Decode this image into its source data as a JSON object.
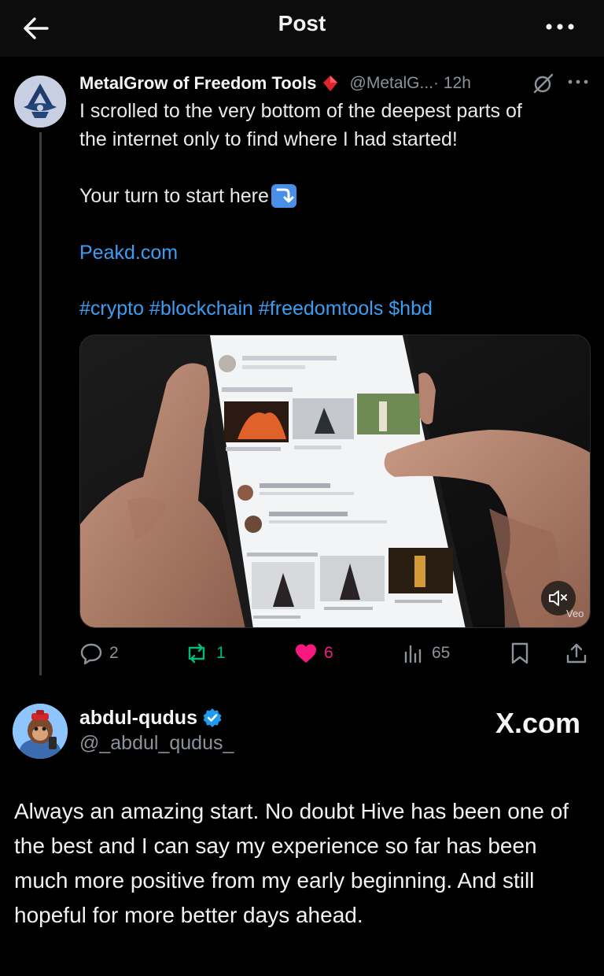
{
  "header": {
    "title": "Post",
    "back_icon": "arrow-left-icon",
    "more_icon": "more-horizontal-icon"
  },
  "post": {
    "author_name": "MetalGrow of Freedom Tools",
    "handle": "@MetalG...",
    "time": "· 12h",
    "lines": [
      "I scrolled to the very bottom of the deepest parts of",
      "the internet only to find where I had started!"
    ],
    "cta": "Your turn to start here",
    "link": "Peakd.com",
    "tags": "#crypto #blockchain #freedomtools $hbd",
    "media": {
      "badge": "Veo",
      "mute_icon": "speaker-muted-icon"
    },
    "actions": {
      "replies": "2",
      "reposts": "1",
      "likes": "6",
      "views": "65"
    },
    "colors": {
      "link": "#3b9ef2",
      "like": "#f91880",
      "repost": "#00ba7c"
    }
  },
  "reply_card": {
    "author_name": "abdul-qudus",
    "handle": "@_abdul_qudus_",
    "source": "X.com",
    "text": "Always an amazing start. No doubt Hive has been one of the best and I can say my experience so far has been much more positive from my early beginning. And still hopeful for more better days ahead."
  }
}
